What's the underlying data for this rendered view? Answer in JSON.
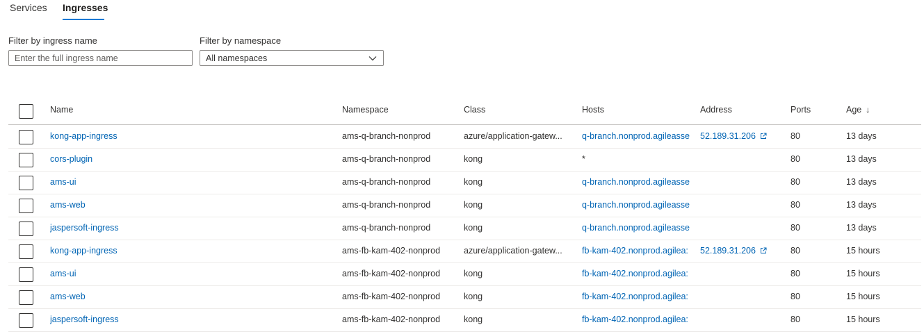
{
  "tabs": [
    {
      "label": "Services",
      "active": false
    },
    {
      "label": "Ingresses",
      "active": true
    }
  ],
  "filters": {
    "name_label": "Filter by ingress name",
    "name_placeholder": "Enter the full ingress name",
    "name_value": "",
    "namespace_label": "Filter by namespace",
    "namespace_value": "All namespaces"
  },
  "colors": {
    "accent": "#0078d4",
    "link": "#0064b4",
    "text": "#323130"
  },
  "table": {
    "columns": [
      "Name",
      "Namespace",
      "Class",
      "Hosts",
      "Address",
      "Ports",
      "Age"
    ],
    "sort_indicator": "↓",
    "rows": [
      {
        "name": "kong-app-ingress",
        "namespace": "ams-q-branch-nonprod",
        "class": "azure/application-gatew...",
        "hosts": "q-branch.nonprod.agileasse",
        "address": "52.189.31.206",
        "ports": "80",
        "age": "13 days"
      },
      {
        "name": "cors-plugin",
        "namespace": "ams-q-branch-nonprod",
        "class": "kong",
        "hosts": "*",
        "address": "",
        "ports": "80",
        "age": "13 days"
      },
      {
        "name": "ams-ui",
        "namespace": "ams-q-branch-nonprod",
        "class": "kong",
        "hosts": "q-branch.nonprod.agileasse",
        "address": "",
        "ports": "80",
        "age": "13 days"
      },
      {
        "name": "ams-web",
        "namespace": "ams-q-branch-nonprod",
        "class": "kong",
        "hosts": "q-branch.nonprod.agileasse",
        "address": "",
        "ports": "80",
        "age": "13 days"
      },
      {
        "name": "jaspersoft-ingress",
        "namespace": "ams-q-branch-nonprod",
        "class": "kong",
        "hosts": "q-branch.nonprod.agileasse",
        "address": "",
        "ports": "80",
        "age": "13 days"
      },
      {
        "name": "kong-app-ingress",
        "namespace": "ams-fb-kam-402-nonprod",
        "class": "azure/application-gatew...",
        "hosts": "fb-kam-402.nonprod.agilea:",
        "address": "52.189.31.206",
        "ports": "80",
        "age": "15 hours"
      },
      {
        "name": "ams-ui",
        "namespace": "ams-fb-kam-402-nonprod",
        "class": "kong",
        "hosts": "fb-kam-402.nonprod.agilea:",
        "address": "",
        "ports": "80",
        "age": "15 hours"
      },
      {
        "name": "ams-web",
        "namespace": "ams-fb-kam-402-nonprod",
        "class": "kong",
        "hosts": "fb-kam-402.nonprod.agilea:",
        "address": "",
        "ports": "80",
        "age": "15 hours"
      },
      {
        "name": "jaspersoft-ingress",
        "namespace": "ams-fb-kam-402-nonprod",
        "class": "kong",
        "hosts": "fb-kam-402.nonprod.agilea:",
        "address": "",
        "ports": "80",
        "age": "15 hours"
      }
    ]
  }
}
